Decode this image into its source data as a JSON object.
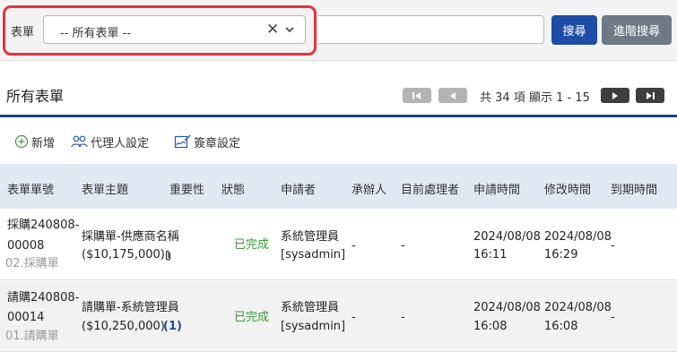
{
  "search": {
    "form_label": "表單",
    "form_select_value": "-- 所有表單 --",
    "search_button": "搜尋",
    "advanced_button": "進階搜尋",
    "highlight_color": "#e8323f",
    "primary_color": "#1e4da8"
  },
  "header": {
    "title": "所有表單",
    "pager_text": "共 34 項 顯示 1 - 15"
  },
  "toolbar": {
    "new_label": "新增",
    "proxy_label": "代理人設定",
    "signature_label": "簽章設定"
  },
  "table": {
    "columns": [
      "表單單號",
      "表單主題",
      "重要性",
      "狀態",
      "申請者",
      "承辦人",
      "目前處理者",
      "申請時間",
      "修改時間",
      "到期時間"
    ],
    "rows": [
      {
        "id_line1": "採購240808-",
        "id_line2": "00008",
        "category": "02.採購單",
        "subject_line1": "採購單-供應商名稱",
        "subject_line2": "($10,175,000)",
        "attachment_icon": "paperclip-icon",
        "status": "已完成",
        "applicant_line1": "系統管理員",
        "applicant_line2": "[sysadmin]",
        "handler": "-",
        "current_processor": "-",
        "apply_date": "2024/08/08",
        "apply_time": "16:11",
        "modify_date": "2024/08/08",
        "modify_time": "16:29",
        "due": "-"
      },
      {
        "id_line1": "請購240808-",
        "id_line2": "00014",
        "category": "01.請購單",
        "subject_line1": "請購單-系統管理員",
        "subject_line2": "($10,250,000)",
        "comment_count": "(1)",
        "status": "已完成",
        "applicant_line1": "系統管理員",
        "applicant_line2": "[sysadmin]",
        "handler": "-",
        "current_processor": "-",
        "apply_date": "2024/08/08",
        "apply_time": "16:08",
        "modify_date": "2024/08/08",
        "modify_time": "16:08",
        "due": "-"
      }
    ]
  }
}
